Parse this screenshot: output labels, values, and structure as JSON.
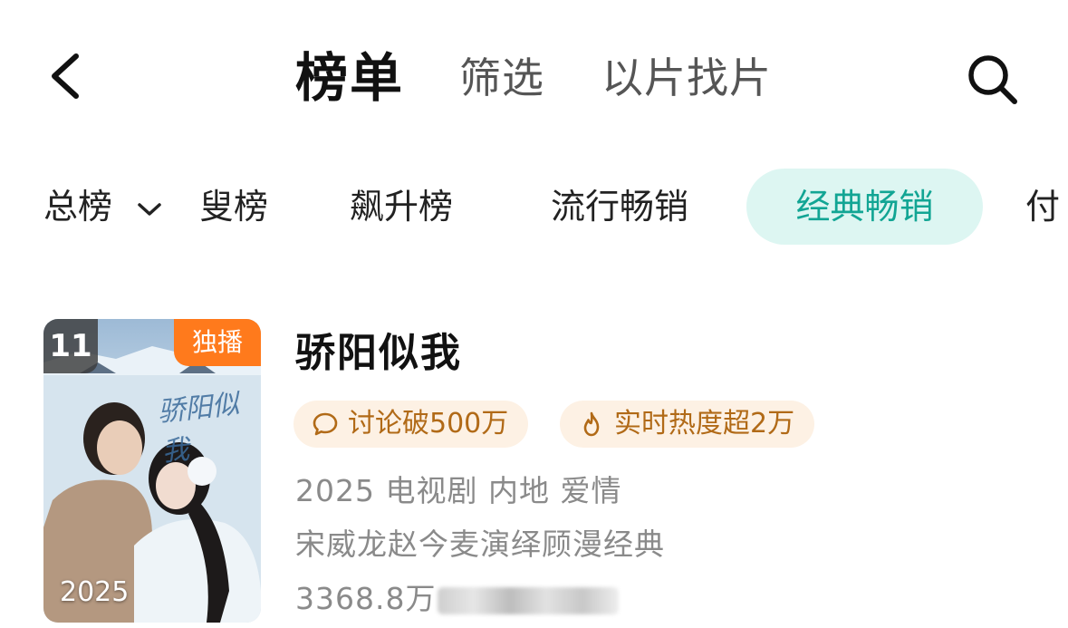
{
  "nav": {
    "title": "榜单",
    "filter_label": "筛选",
    "find_by_clip_label": "以片找片"
  },
  "tabs": {
    "total_label": "总榜",
    "partial_label": "叟榜",
    "rise_label": "飙升榜",
    "popular_label": "流行畅销",
    "classic_label": "经典畅销",
    "paid_label": "付"
  },
  "show": {
    "rank": "11",
    "exclusive_label": "独播",
    "poster_year": "2025",
    "poster_art_text": "骄阳似我",
    "title": "骄阳似我",
    "tag_discussion": "讨论破500万",
    "tag_hot": "实时热度超2万",
    "meta_basic": "2025 电视剧 内地 爱情",
    "meta_desc": "宋威龙赵今麦演绎顾漫经典",
    "heat_value": "3368.8万"
  },
  "colors": {
    "accent_teal": "#12a594",
    "accent_teal_bg": "#ddf6f2",
    "tag_bg": "#fdf1e4",
    "tag_text": "#b16a17",
    "exclusive_orange": "#ff7a1c"
  },
  "icons": {
    "back": "chevron-left-icon",
    "search": "search-icon",
    "dropdown": "chevron-down-icon",
    "discussion": "speech-bubble-icon",
    "hot": "flame-icon"
  }
}
